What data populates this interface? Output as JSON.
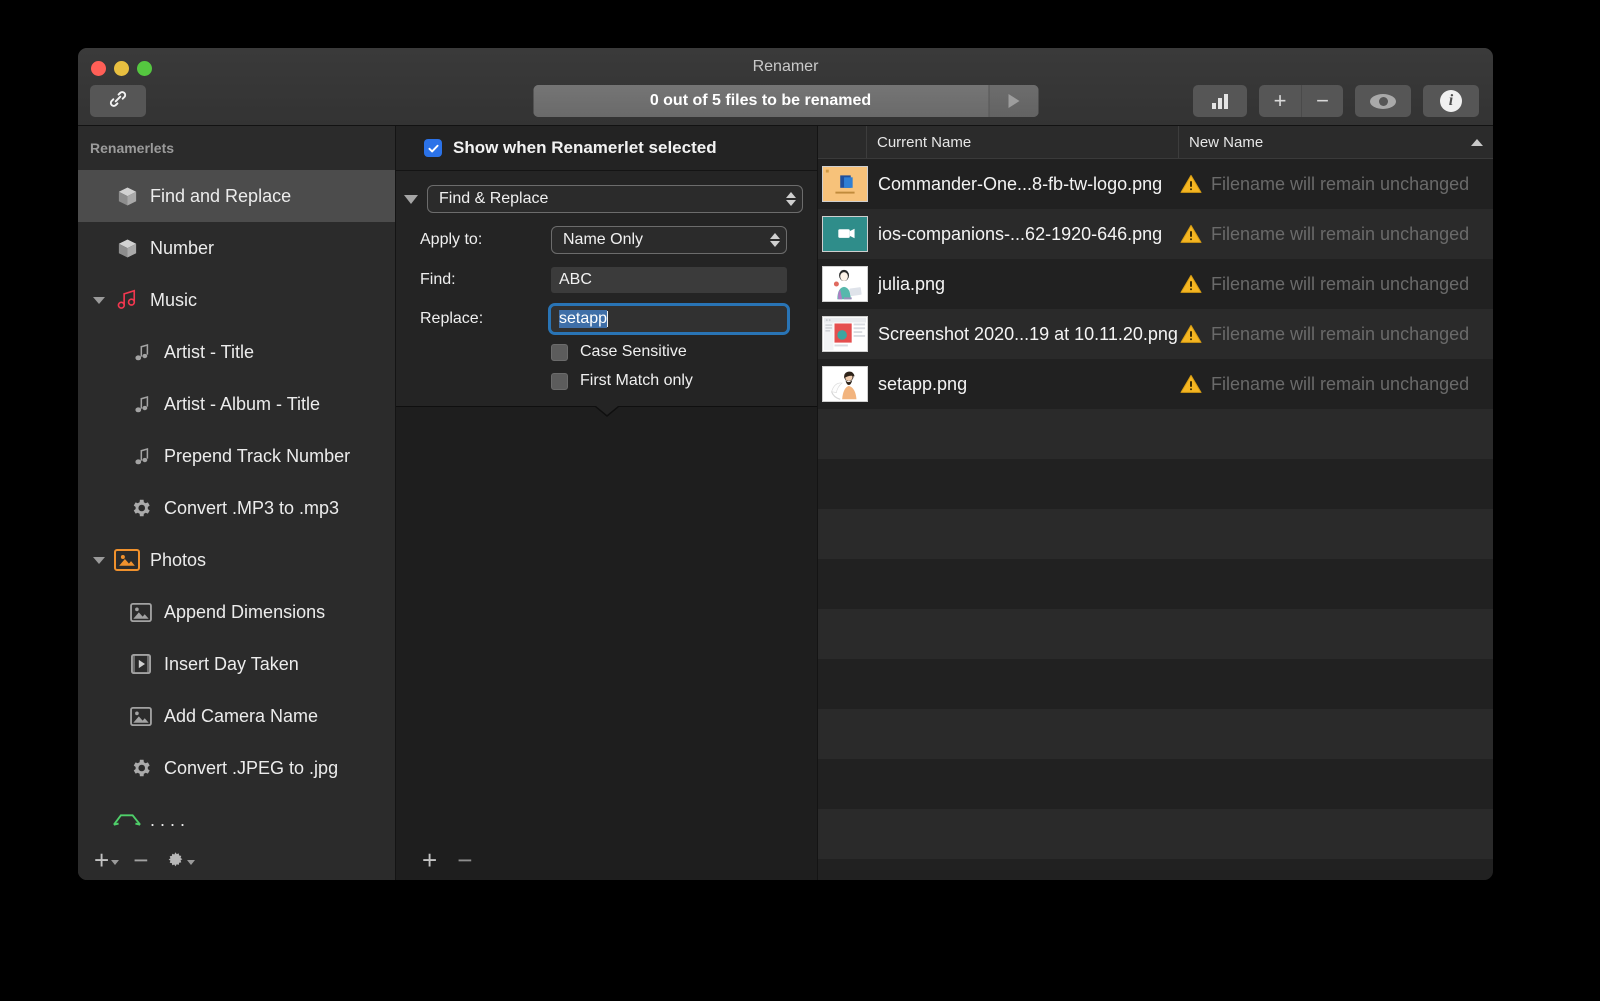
{
  "window": {
    "title": "Renamer",
    "traffic_lights": [
      "close-red",
      "minimize-yellow",
      "maximize-green"
    ]
  },
  "toolbar": {
    "link_icon": "link-icon",
    "progress_label": "0 out of 5 files to be renamed",
    "run_icon": "play-triangle-icon",
    "chart_icon": "bar-chart-icon",
    "add_label": "+",
    "remove_label": "−",
    "eye_icon": "eye-icon",
    "info_label": "i"
  },
  "sidebar": {
    "header": "Renamerlets",
    "items": [
      {
        "label": "Find and Replace",
        "icon": "cube-icon",
        "level": 0,
        "selected": true,
        "twisty": "none"
      },
      {
        "label": "Number",
        "icon": "cube-icon",
        "level": 0,
        "selected": false,
        "twisty": "none"
      },
      {
        "label": "Music",
        "icon": "music-notes-icon",
        "level": 0,
        "selected": false,
        "twisty": "down"
      },
      {
        "label": "Artist - Title",
        "icon": "note-icon",
        "level": 1,
        "selected": false,
        "twisty": "none"
      },
      {
        "label": "Artist - Album - Title",
        "icon": "note-icon",
        "level": 1,
        "selected": false,
        "twisty": "none"
      },
      {
        "label": "Prepend Track Number",
        "icon": "note-icon",
        "level": 1,
        "selected": false,
        "twisty": "none"
      },
      {
        "label": "Convert .MP3 to .mp3",
        "icon": "gear-icon",
        "level": 1,
        "selected": false,
        "twisty": "none"
      },
      {
        "label": "Photos",
        "icon": "photo-badge-icon",
        "level": 0,
        "selected": false,
        "twisty": "down"
      },
      {
        "label": "Append Dimensions",
        "icon": "image-icon",
        "level": 1,
        "selected": false,
        "twisty": "none"
      },
      {
        "label": "Insert Day Taken",
        "icon": "film-icon",
        "level": 1,
        "selected": false,
        "twisty": "none"
      },
      {
        "label": "Add Camera Name",
        "icon": "image-icon",
        "level": 1,
        "selected": false,
        "twisty": "none"
      },
      {
        "label": "Convert .JPEG to .jpg",
        "icon": "gear-icon",
        "level": 1,
        "selected": false,
        "twisty": "none"
      },
      {
        "label": ".  . . .",
        "icon": "green-arrows-icon",
        "level": 0,
        "selected": false,
        "twisty": "none"
      }
    ],
    "footer": {
      "add_label": "+",
      "remove_label": "−",
      "gear_icon": "gear-icon"
    }
  },
  "center": {
    "show_checkbox": {
      "label": "Show when Renamerlet selected",
      "checked": true
    },
    "renamerlet_popup": "Find & Replace",
    "fields": {
      "apply_to_label": "Apply to:",
      "apply_to_value": "Name Only",
      "find_label": "Find:",
      "find_value": "ABC",
      "replace_label": "Replace:",
      "replace_value": "setapp"
    },
    "options": [
      {
        "label": "Case Sensitive",
        "checked": false
      },
      {
        "label": "First Match only",
        "checked": false
      }
    ],
    "footer": {
      "add_label": "+",
      "remove_label": "−"
    }
  },
  "filelist": {
    "columns": [
      "Current Name",
      "New Name"
    ],
    "sort_indicator": "chevron-up-icon",
    "rows": [
      {
        "thumb": "commander-one-thumb",
        "current_name": "Commander-One...8-fb-tw-logo.png",
        "warning": "warning-triangle-icon",
        "new_name": "Filename will remain unchanged"
      },
      {
        "thumb": "ios-companions-thumb",
        "current_name": "ios-companions-...62-1920-646.png",
        "warning": "warning-triangle-icon",
        "new_name": "Filename will remain unchanged"
      },
      {
        "thumb": "julia-thumb",
        "current_name": "julia.png",
        "warning": "warning-triangle-icon",
        "new_name": "Filename will remain unchanged"
      },
      {
        "thumb": "screenshot-thumb",
        "current_name": "Screenshot 2020...19 at 10.11.20.png",
        "warning": "warning-triangle-icon",
        "new_name": "Filename will remain unchanged"
      },
      {
        "thumb": "setapp-thumb",
        "current_name": "setapp.png",
        "warning": "warning-triangle-icon",
        "new_name": "Filename will remain unchanged"
      }
    ],
    "empty_row_count": 9
  },
  "colors": {
    "accent_blue": "#2b72e8",
    "focus_ring": "#2974b5",
    "warning_yellow": "#f5b622",
    "photos_orange": "#f0912d",
    "music_red": "#f2374f",
    "green": "#4fd06a"
  }
}
